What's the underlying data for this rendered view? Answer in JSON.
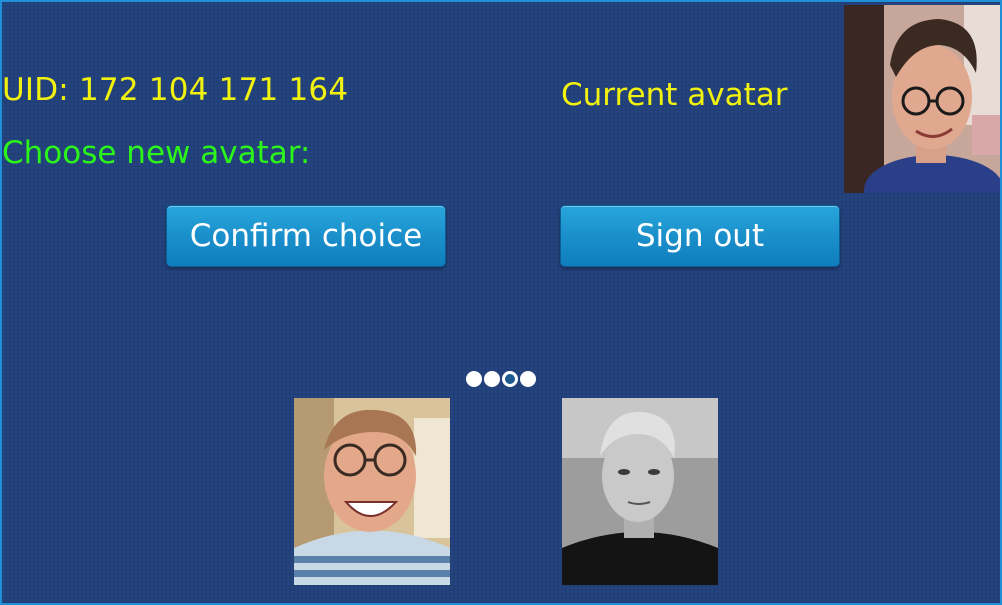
{
  "header": {
    "uid_text": "UID: 172 104 171 164",
    "choose_text": "Choose new avatar:",
    "current_avatar_label": "Current avatar"
  },
  "buttons": {
    "confirm_label": "Confirm choice",
    "signout_label": "Sign out"
  },
  "carousel": {
    "dot_count": 4,
    "active_index": 2
  },
  "colors": {
    "background": "#21407a",
    "uid_text": "#f2f20e",
    "choose_text": "#2cf51a",
    "button": "#1a90cb"
  }
}
